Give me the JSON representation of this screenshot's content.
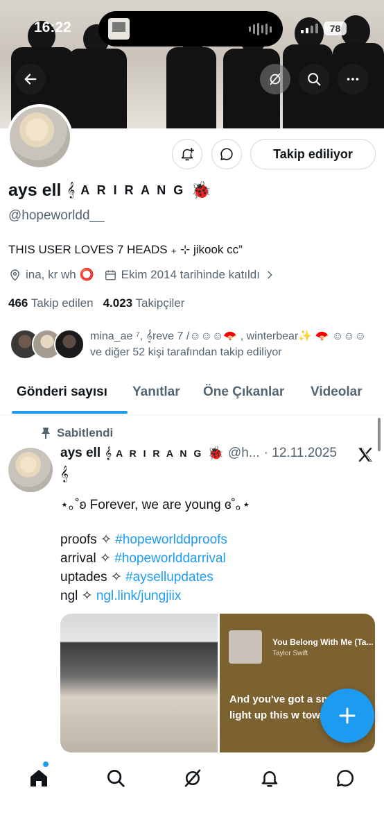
{
  "status_bar": {
    "time": "16:22",
    "battery": "78"
  },
  "profile": {
    "name": "ays ell",
    "name_decoration": "A R I R A N G",
    "handle": "@hopeworldd__",
    "bio": "THIS USER LOVES 7 HEADS ₊ ⊹ jikook cc”",
    "location": "ina, kr wh ⭕",
    "joined": "Ekim 2014 tarihinde katıldı",
    "following_count": "466",
    "following_label": "Takip edilen",
    "followers_count": "4.023",
    "followers_label": "Takipçiler",
    "followed_by": "mina_ae ⁷, 𝄞reve 7 /☺☺☺🪭 , winterbear✨ 🪭 ☺☺☺ ve diğer 52 kişi tarafından takip ediliyor",
    "follow_button": "Takip ediliyor"
  },
  "tabs": [
    {
      "label": "Gönderi sayısı",
      "active": true
    },
    {
      "label": "Yanıtlar",
      "active": false
    },
    {
      "label": "Öne Çıkanlar",
      "active": false
    },
    {
      "label": "Videolar",
      "active": false
    }
  ],
  "post": {
    "pinned_label": "Sabitlendi",
    "author": "ays ell",
    "author_decoration": "A R I R A N G",
    "handle_truncated": "@h...",
    "date": "· 12.11.2025",
    "line1": "⋆｡˚ʚ Forever, we are young ɞ˚｡⋆",
    "links": [
      {
        "prefix": "proofs ✧",
        "link": "#hopeworlddproofs"
      },
      {
        "prefix": "arrival ✧",
        "link": "#hopeworlddarrival"
      },
      {
        "prefix": "uptades ✧",
        "link": "#aysellupdates"
      },
      {
        "prefix": "ngl ✧",
        "link": "ngl.link/jungjiix"
      }
    ],
    "spotify": {
      "title": "You Belong With Me (Ta...",
      "artist": "Taylor Swift",
      "lyrics": "And you've got a sm can light up this w town"
    }
  },
  "colors": {
    "accent": "#1d9bf0",
    "text": "#0f1419",
    "muted": "#536471"
  }
}
